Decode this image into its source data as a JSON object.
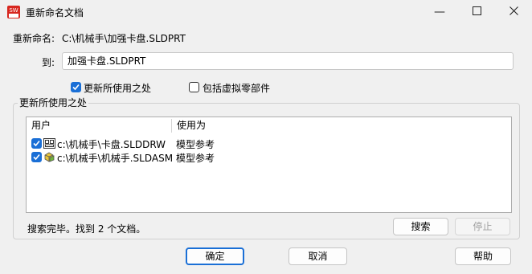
{
  "window": {
    "title": "重新命名文档",
    "minimize_glyph": "—",
    "maximize_glyph": "☐",
    "close_glyph": "✕"
  },
  "rename": {
    "label": "重新命名:",
    "source_path": "C:\\机械手\\加强卡盘.SLDPRT",
    "to_label": "到:",
    "to_value": "加强卡盘.SLDPRT"
  },
  "options": {
    "update_where_used": {
      "label": "更新所使用之处",
      "checked": true
    },
    "include_virtual": {
      "label": "包括虚拟零部件",
      "checked": false
    }
  },
  "group": {
    "title": "更新所使用之处",
    "columns": [
      "用户",
      "使用为"
    ],
    "rows": [
      {
        "checked": true,
        "icon": "drawing-file-icon",
        "file": "c:\\机械手\\卡盘.SLDDRW",
        "usage": "模型参考"
      },
      {
        "checked": true,
        "icon": "assembly-file-icon",
        "file": "c:\\机械手\\机械手.SLDASM",
        "usage": "模型参考"
      }
    ],
    "status": "搜索完毕。找到 2 个文档。",
    "search_button": "搜索",
    "stop_button": "停止"
  },
  "buttons": {
    "ok": "确定",
    "cancel": "取消",
    "help": "帮助"
  },
  "colors": {
    "accent": "#1a6fd6",
    "background": "#f0f0f0"
  }
}
